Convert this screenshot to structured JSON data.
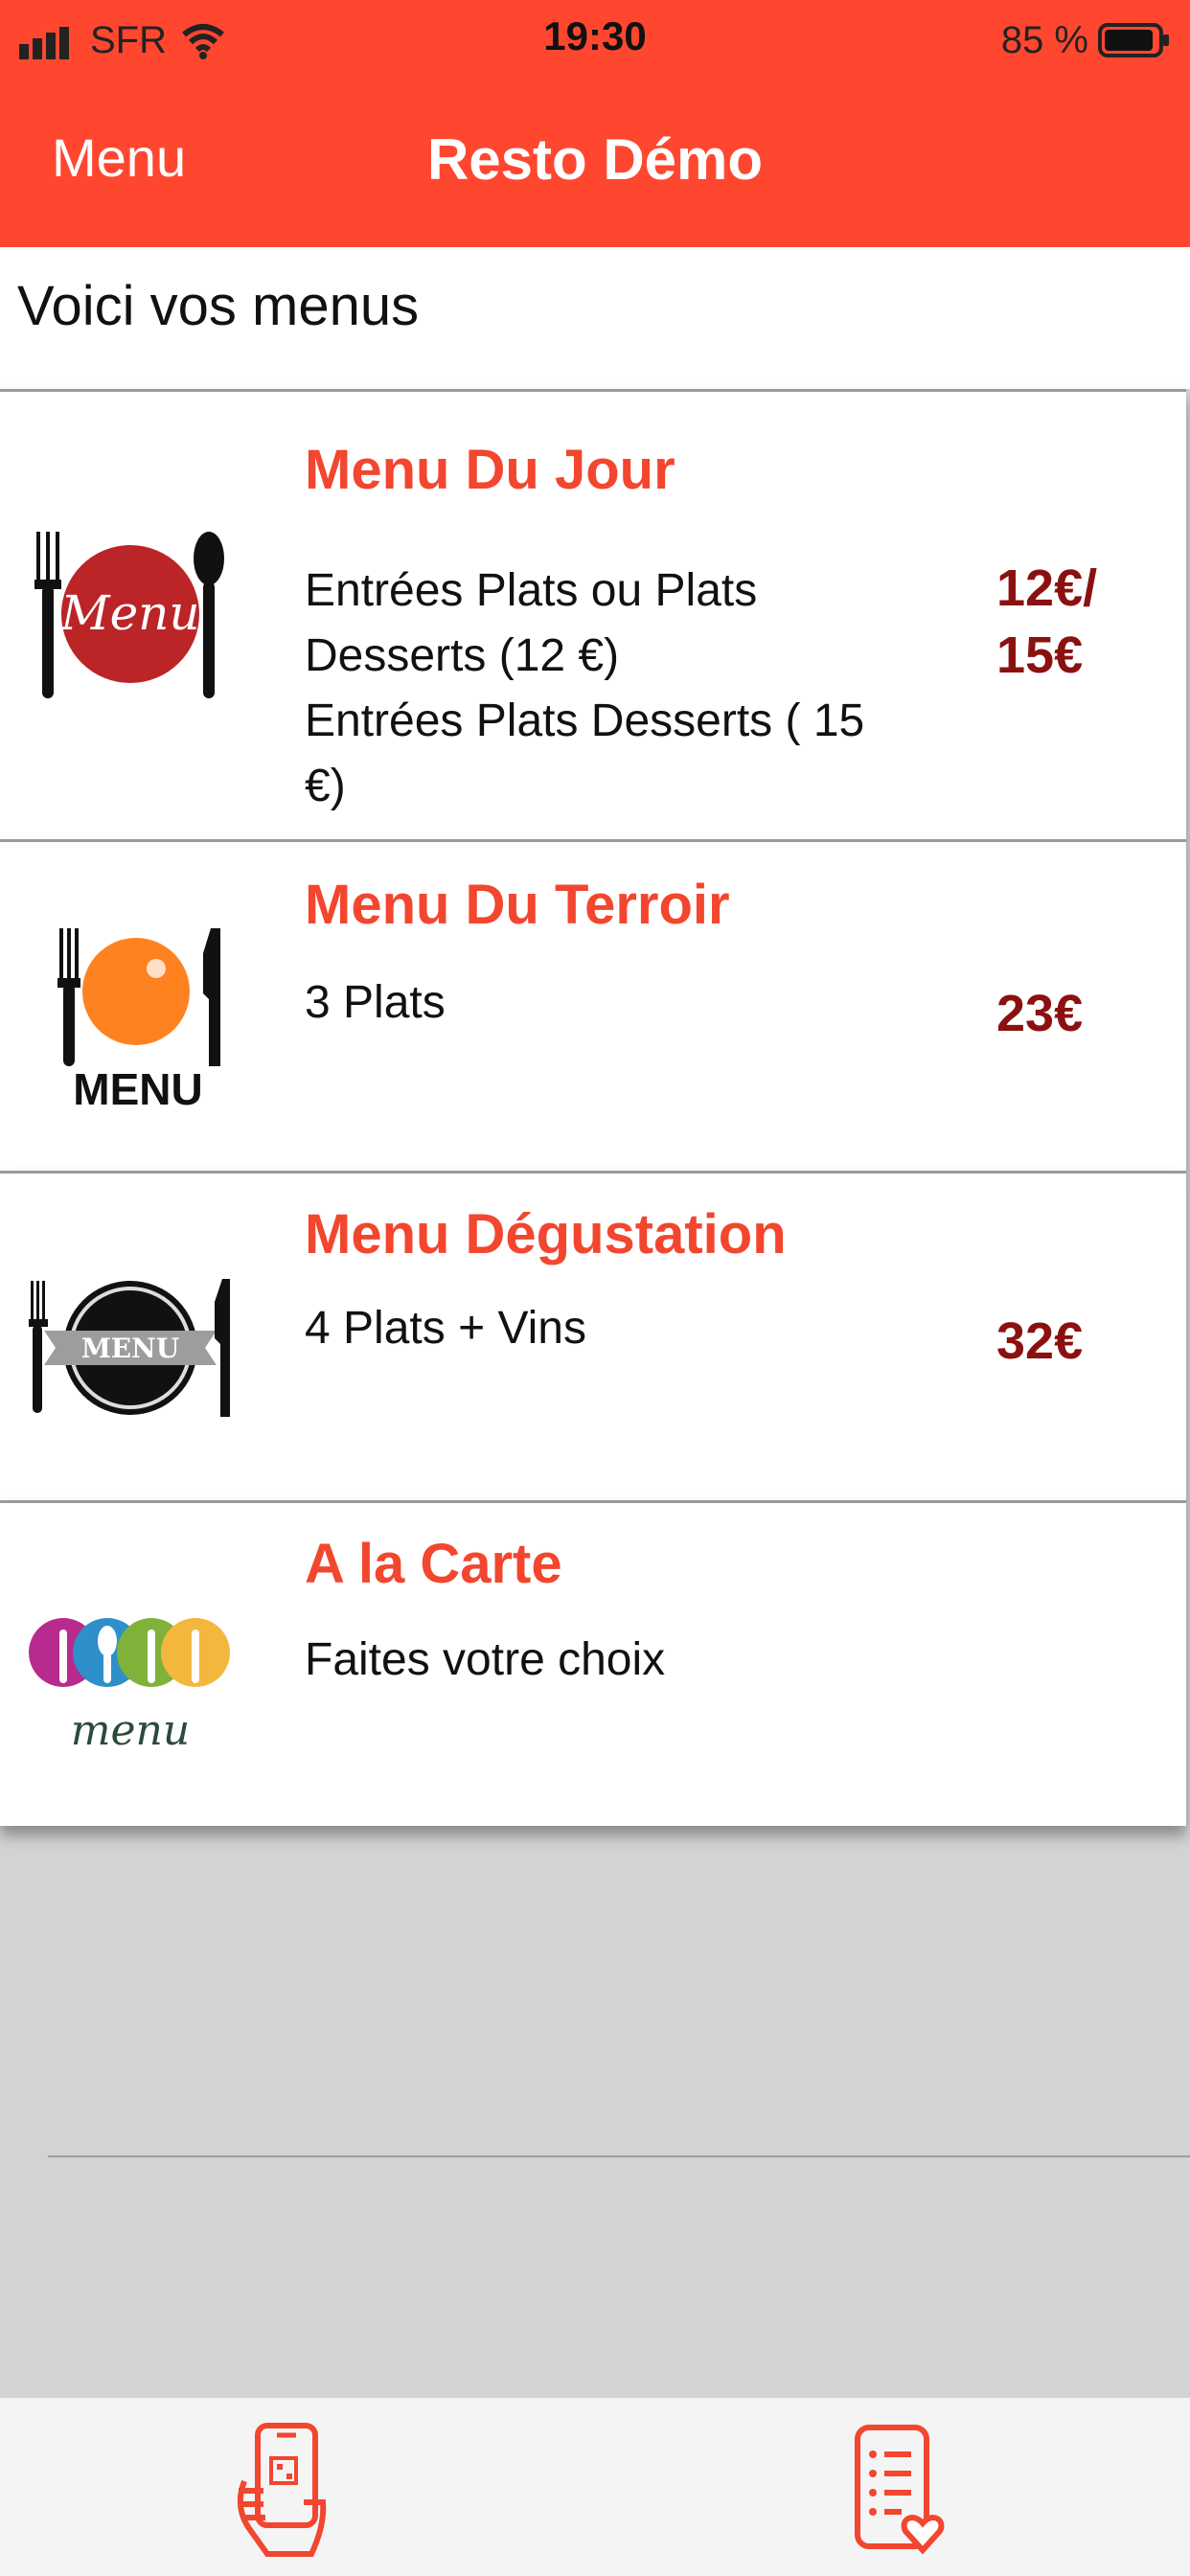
{
  "status_bar": {
    "carrier": "SFR",
    "time": "19:30",
    "battery": "85 %"
  },
  "nav": {
    "left": "Menu",
    "title": "Resto Démo"
  },
  "subheader": "Voici vos menus",
  "menus": [
    {
      "title": "Menu Du Jour",
      "desc_lines": [
        "Entrées Plats ou Plats",
        "Desserts (12 €)",
        "Entrées Plats Desserts ( 15",
        "€)"
      ],
      "price_lines": [
        "12€/",
        "15€"
      ]
    },
    {
      "title": "Menu Du Terroir",
      "desc_lines": [
        "3 Plats"
      ],
      "price_lines": [
        "23€"
      ]
    },
    {
      "title": "Menu Dégustation",
      "desc_lines": [
        "4 Plats + Vins"
      ],
      "price_lines": [
        "32€"
      ]
    },
    {
      "title": "A la Carte",
      "desc_lines": [
        "Faites votre choix"
      ],
      "price_lines": []
    }
  ],
  "logos": {
    "menu_jour_word": "Menu",
    "menu_terroir_word": "MENU",
    "menu_degustation_word": "MENU",
    "a_la_carte_word": "menu"
  },
  "icons": {
    "tab1": "phone-qr-hand-icon",
    "tab2": "list-heart-icon"
  },
  "colors": {
    "brand": "#ff4730",
    "title": "#f2462f",
    "price": "#8b1111"
  }
}
